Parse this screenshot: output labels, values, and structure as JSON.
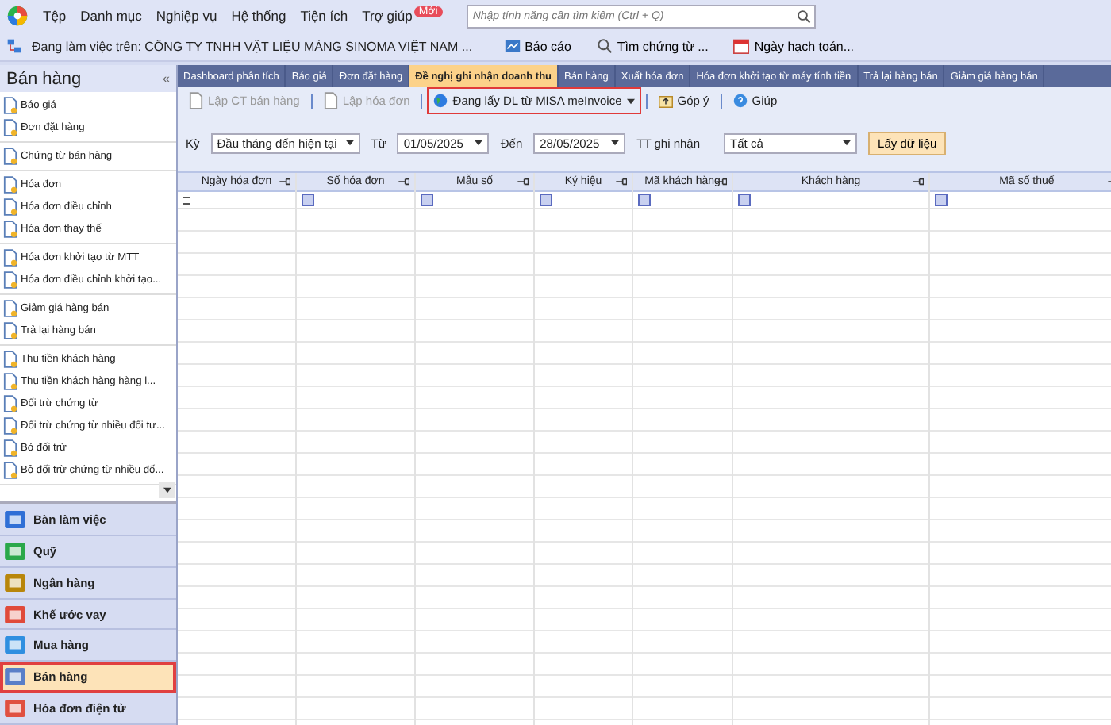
{
  "menubar": {
    "items": [
      "Tệp",
      "Danh mục",
      "Nghiệp vụ",
      "Hệ thống",
      "Tiện ích",
      "Trợ giúp"
    ],
    "badge": "Mới",
    "search": {
      "placeholder": "Nhập tính năng cần tìm kiếm (Ctrl + Q)"
    }
  },
  "toolbar": {
    "workspace": "Đang làm việc trên: CÔNG TY TNHH VẬT LIỆU MÀNG SINOMA VIỆT NAM ...",
    "buttons": [
      {
        "kind": "report",
        "label": "Báo cáo"
      },
      {
        "kind": "search",
        "label": "Tìm chứng từ ..."
      },
      {
        "kind": "calendar",
        "label": "Ngày hạch toán..."
      }
    ]
  },
  "sidebar": {
    "title": "Bán hàng",
    "collapse": "«",
    "groups": [
      [
        "Báo giá",
        "Đơn đặt hàng"
      ],
      [
        "Chứng từ bán hàng"
      ],
      [
        "Hóa đơn",
        "Hóa đơn điều chỉnh",
        "Hóa đơn thay thế"
      ],
      [
        "Hóa đơn khởi tạo từ MTT",
        "Hóa đơn điều chỉnh khởi tạo..."
      ],
      [
        "Giảm giá hàng bán",
        "Trả lại hàng bán"
      ],
      [
        "Thu tiền khách hàng",
        "Thu tiền khách hàng hàng l...",
        "Đối trừ chứng từ",
        "Đối trừ chứng từ nhiều đối tư...",
        "Bỏ đối trừ",
        "Bỏ đối trừ chứng từ nhiều đố..."
      ]
    ],
    "modules": [
      {
        "kind": "desk",
        "label": "Bàn làm việc",
        "selected": false
      },
      {
        "kind": "cash",
        "label": "Quỹ",
        "selected": false
      },
      {
        "kind": "bank",
        "label": "Ngân hàng",
        "selected": false
      },
      {
        "kind": "loan",
        "label": "Khế ước vay",
        "selected": false
      },
      {
        "kind": "cart",
        "label": "Mua hàng",
        "selected": false
      },
      {
        "kind": "shop",
        "label": "Bán hàng",
        "selected": true
      },
      {
        "kind": "invoice",
        "label": "Hóa đơn điện tử",
        "selected": false
      }
    ]
  },
  "tabs": [
    {
      "label": "Dashboard phân tích",
      "selected": false
    },
    {
      "label": "Báo giá",
      "selected": false
    },
    {
      "label": "Đơn đặt hàng",
      "selected": false
    },
    {
      "label": "Đề nghị ghi nhận doanh thu",
      "selected": true
    },
    {
      "label": "Bán hàng",
      "selected": false
    },
    {
      "label": "Xuất hóa đơn",
      "selected": false
    },
    {
      "label": "Hóa đơn khởi tạo từ máy tính tiền",
      "selected": false
    },
    {
      "label": "Trả lại hàng bán",
      "selected": false
    },
    {
      "label": "Giảm giá hàng bán",
      "selected": false
    }
  ],
  "actions": [
    {
      "kind": "doc",
      "label": "Lập CT bán hàng",
      "disabled": true,
      "highlighted": false
    },
    {
      "kind": "doc",
      "label": "Lập hóa đơn",
      "disabled": true,
      "highlighted": false
    },
    {
      "kind": "globe",
      "label": "Đang lấy DL từ MISA meInvoice",
      "disabled": false,
      "highlighted": true
    },
    {
      "kind": "feedback",
      "label": "Góp ý",
      "disabled": false,
      "highlighted": false
    },
    {
      "kind": "help",
      "label": "Giúp",
      "disabled": false,
      "highlighted": false
    }
  ],
  "filters": {
    "period_label": "Kỳ",
    "period": "Đầu tháng đến hiện tại",
    "from_label": "Từ",
    "from": "01/05/2025",
    "to_label": "Đến",
    "to": "28/05/2025",
    "status_label": "TT ghi nhận",
    "status": "Tất cả",
    "fetch_button": "Lấy dữ liệu"
  },
  "table": {
    "columns": [
      {
        "label": "Ngày hóa đơn",
        "kind": "equals"
      },
      {
        "label": "Số hóa đơn",
        "kind": "box"
      },
      {
        "label": "Mẫu số",
        "kind": "box"
      },
      {
        "label": "Ký hiệu",
        "kind": "box"
      },
      {
        "label": "Mã khách hàng",
        "kind": "box"
      },
      {
        "label": "Khách hàng",
        "kind": "box"
      },
      {
        "label": "Mã số thuế",
        "kind": "box"
      }
    ]
  }
}
